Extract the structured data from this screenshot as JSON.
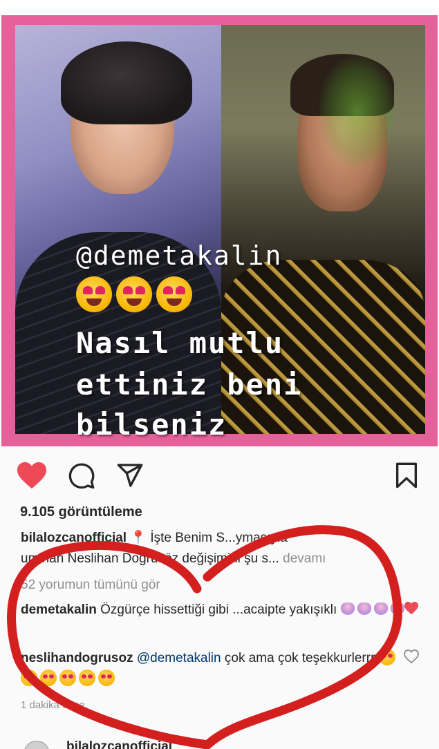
{
  "post": {
    "overlay_mention": "@demetakalin",
    "overlay_line1": "Nasıl mutlu",
    "overlay_line2": "ettiniz beni",
    "overlay_line3": "bilseniz",
    "overlay_emoji_count": 3
  },
  "actions": {
    "like_icon": "heart-icon",
    "comment_icon": "comment-icon",
    "share_icon": "send-icon",
    "save_icon": "bookmark-icon"
  },
  "stats": {
    "views": "9.105 görüntüleme"
  },
  "caption": {
    "username": "bilalozcanofficial",
    "text_part1": " İşte Benim S",
    "text_hidden": "...",
    "text_part2": "ymasıyla",
    "line2": "uminan Neslihan Doğrusöz değişimini şu s...",
    "more": "devamı"
  },
  "comments": {
    "view_all": "52 yorumun tümünü gör",
    "items": [
      {
        "username": "demetakalin",
        "text": "Özgürçe hissettiği gibi ...acaipte yakışıklı"
      },
      {
        "username": "neslihandogrusoz",
        "mention": "@demetakalin",
        "text": "çok ama çok teşekkurlerrr"
      }
    ],
    "timestamp": "1 dakika önce"
  },
  "next_post": {
    "username": "bilalozcanofficial"
  },
  "colors": {
    "like_red": "#ed4956",
    "frame_pink": "#e4619a",
    "scribble_red": "#d41f1f"
  }
}
